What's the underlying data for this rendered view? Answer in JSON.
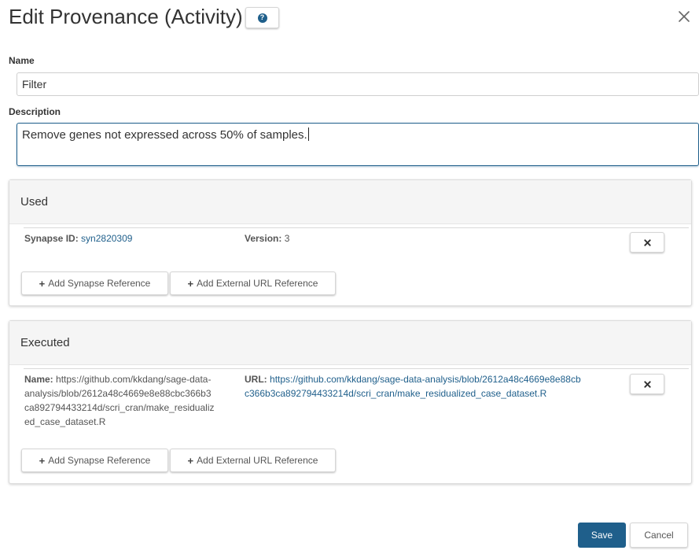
{
  "dialog": {
    "title": "Edit Provenance (Activity)",
    "help_icon": "question-circle-icon",
    "close_icon": "close-icon"
  },
  "form": {
    "name_label": "Name",
    "name_value": "Filter",
    "description_label": "Description",
    "description_value": "Remove genes not expressed across 50% of samples."
  },
  "used": {
    "heading": "Used",
    "entries": [
      {
        "id_label": "Synapse ID:",
        "id_value": "syn2820309",
        "version_label": "Version:",
        "version_value": "3",
        "remove_icon": "times-icon"
      }
    ],
    "add_synapse_label": "Add Synapse Reference",
    "add_url_label": "Add External URL Reference"
  },
  "executed": {
    "heading": "Executed",
    "entries": [
      {
        "name_label": "Name:",
        "name_lines": [
          "https://github.com/kkdang/sage-data-",
          "analysis/blob/2612a48c4669e8e88cbc366b3",
          "ca892794433214d/scri_cran/make_residualiz",
          "ed_case_dataset.R"
        ],
        "url_label": "URL:",
        "url_lines": [
          "https://github.com/kkdang/sage-data-analysis/blob/2612a48c4669e8e88cb",
          "c366b3ca892794433214d/scri_cran/make_residualized_case_dataset.R"
        ],
        "remove_icon": "times-icon"
      }
    ],
    "add_synapse_label": "Add Synapse Reference",
    "add_url_label": "Add External URL Reference"
  },
  "footer": {
    "save_label": "Save",
    "cancel_label": "Cancel"
  },
  "colors": {
    "primary": "#1f5f8b",
    "link": "#1f5f8b",
    "panel_header_bg": "#f5f5f5"
  }
}
